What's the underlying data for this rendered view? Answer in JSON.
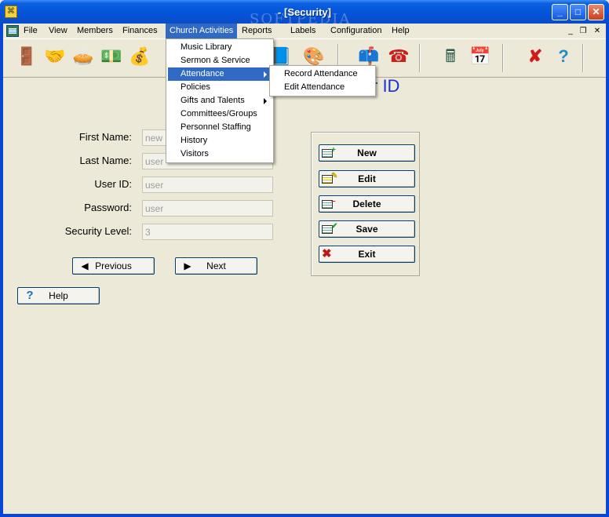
{
  "window": {
    "title": "- [Security]",
    "watermark": "SOFTPEDIA",
    "controls": {
      "minimize": "_",
      "maximize": "□",
      "close": "✕"
    }
  },
  "menubar": {
    "items": [
      "File",
      "View",
      "Members",
      "Finances",
      "Church Activities",
      "Reports",
      "Labels",
      "Configuration",
      "Help"
    ],
    "active": "Church Activities",
    "mdi_controls": {
      "minimize": "_",
      "restore": "❐",
      "close": "✕"
    }
  },
  "toolbar": {
    "icons": [
      "exit-door-icon",
      "handshake-icon",
      "pie-icon",
      "money-icon",
      "offering-icon",
      "book-icon",
      "paint-palette-icon",
      "mailbox-icon",
      "telephone-icon",
      "calculator-icon",
      "calendar-icon",
      "close-x-icon",
      "help-question-icon"
    ]
  },
  "church_activities_menu": {
    "items": [
      "Music Library",
      "Sermon & Service",
      "Attendance",
      "Policies",
      "Gifts and Talents",
      "Committees/Groups",
      "Personnel Staffing",
      "History",
      "Visitors"
    ],
    "highlighted": "Attendance",
    "has_submenu": [
      "Attendance",
      "Gifts and Talents"
    ]
  },
  "attendance_submenu": {
    "items": [
      "Record Attendance",
      "Edit Attendance"
    ]
  },
  "form": {
    "heading_visible": "r ID",
    "fields": [
      {
        "label": "First Name:",
        "value": "new"
      },
      {
        "label": "Last Name:",
        "value": "user"
      },
      {
        "label": "User ID:",
        "value": "user"
      },
      {
        "label": "Password:",
        "value": "user"
      },
      {
        "label": "Security Level:",
        "value": "3"
      }
    ],
    "previous_label": "Previous",
    "next_label": "Next",
    "help_label": "Help"
  },
  "actions": {
    "new_label": "New",
    "edit_label": "Edit",
    "delete_label": "Delete",
    "save_label": "Save",
    "exit_label": "Exit"
  },
  "colors": {
    "titlebar": "#0553d8",
    "menu_highlight": "#316ac5",
    "heading": "#1b2fd6"
  }
}
